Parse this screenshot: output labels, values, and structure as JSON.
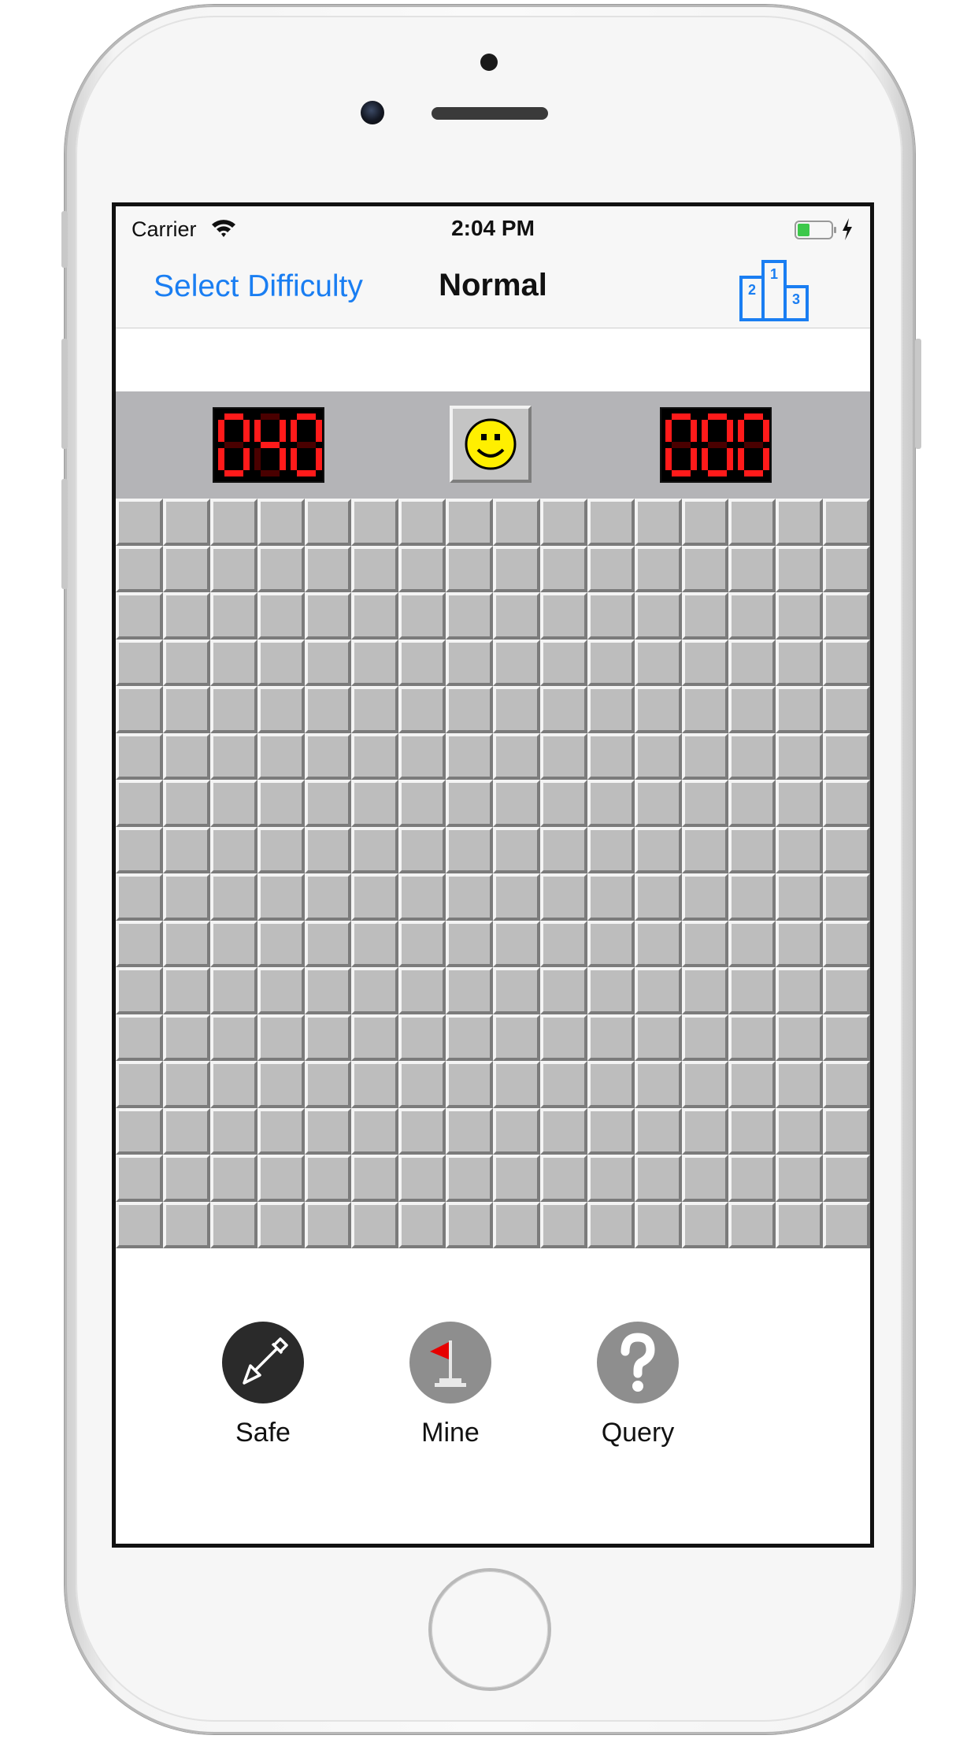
{
  "status_bar": {
    "carrier": "Carrier",
    "time": "2:04 PM"
  },
  "nav": {
    "select_difficulty": "Select Difficulty",
    "title": "Normal",
    "leaderboard_icon": "podium-icon"
  },
  "scoreboard": {
    "mines_remaining": "040",
    "timer": "000",
    "reset_icon": "smiley-face-icon"
  },
  "board": {
    "rows": 16,
    "columns": 16,
    "state": "unrevealed"
  },
  "tools": [
    {
      "label": "Safe",
      "icon": "shovel-icon",
      "color": "#2a2a2a",
      "selected": true
    },
    {
      "label": "Mine",
      "icon": "flag-icon",
      "color": "#8e8e8e",
      "selected": false
    },
    {
      "label": "Query",
      "icon": "question-mark-icon",
      "color": "#8e8e8e",
      "selected": false
    }
  ],
  "colors": {
    "link": "#1a7ef2",
    "led_on": "#ff1a1a",
    "led_off": "#4a0000",
    "scoreboard": "#b4b4b7",
    "cell": "#bdbdbd"
  }
}
